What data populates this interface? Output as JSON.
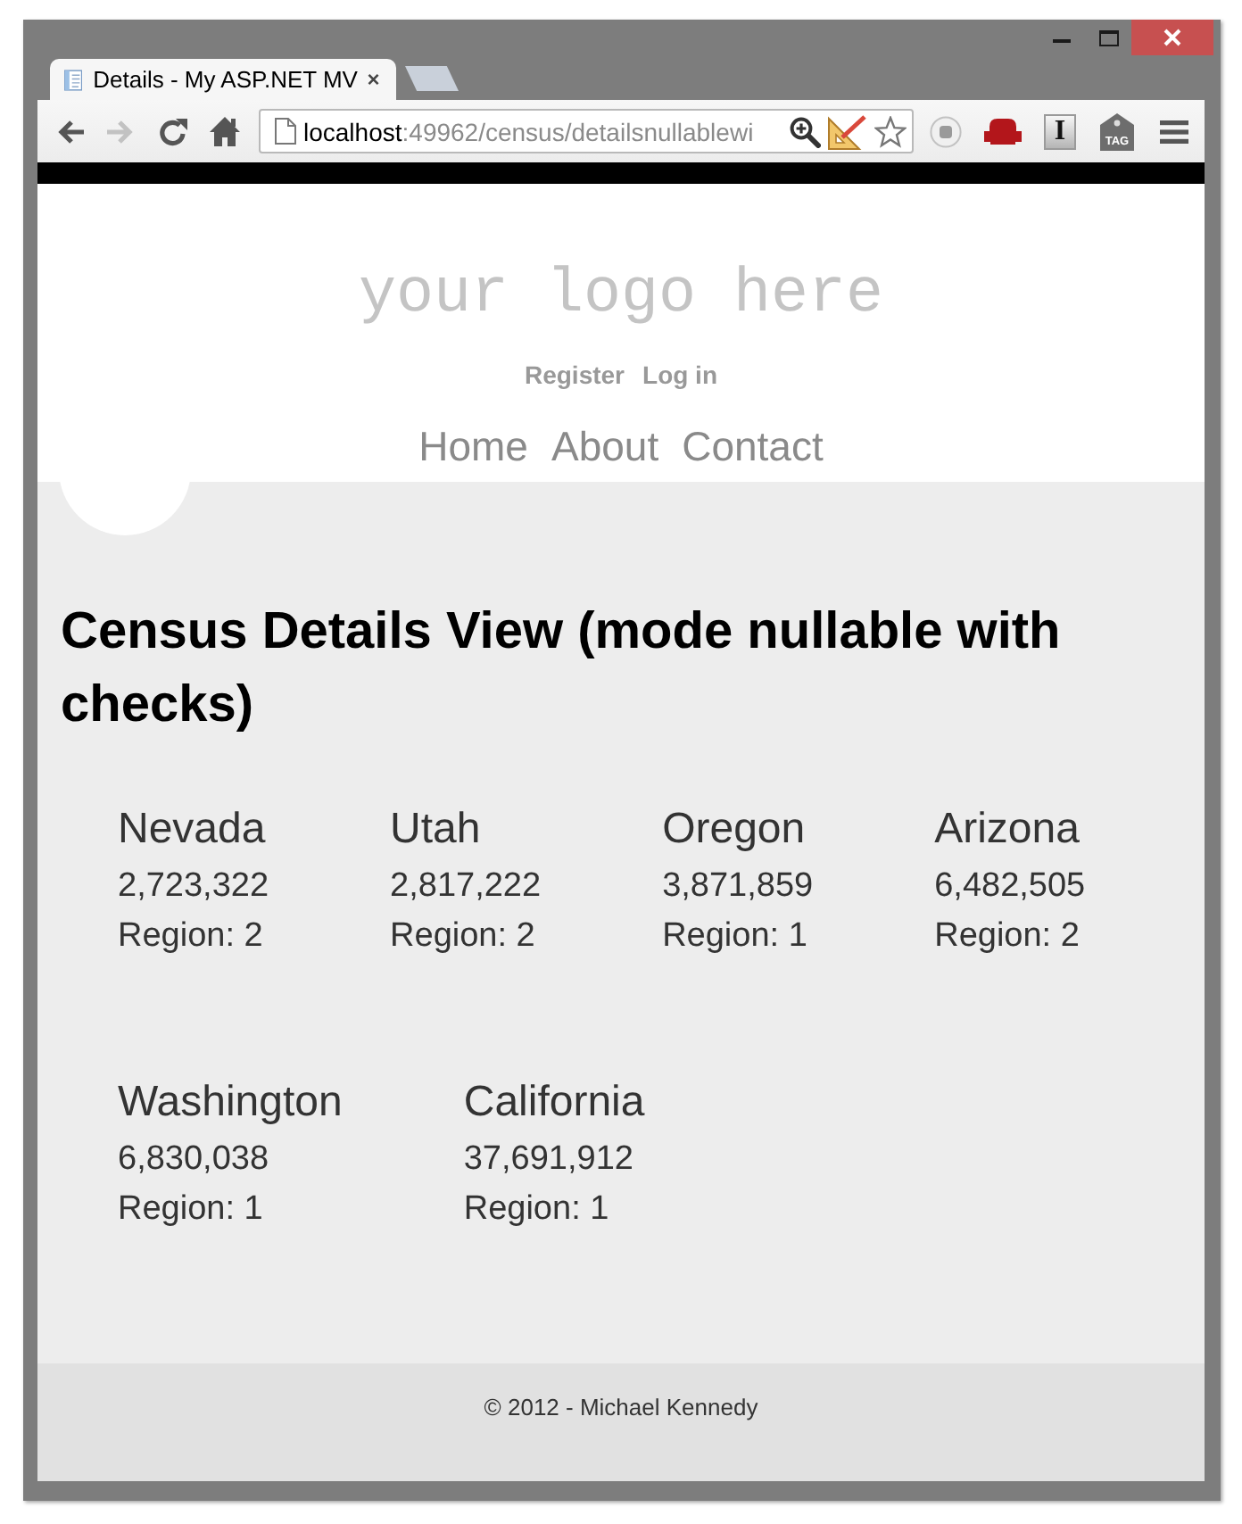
{
  "browser": {
    "tabs": [
      {
        "title": "Details - My ASP.NET MV",
        "selected": true
      }
    ],
    "nav_buttons": [
      {
        "kind": "back",
        "disabled": false
      },
      {
        "kind": "forward",
        "disabled": true
      },
      {
        "kind": "reload",
        "disabled": false
      },
      {
        "kind": "home",
        "disabled": false
      }
    ],
    "address_bar": {
      "host": "localhost",
      "path": ":49962/census/detailsnullablewi"
    },
    "extensions": [
      {
        "kind": "record"
      },
      {
        "kind": "sofa"
      },
      {
        "kind": "letter",
        "label": "I"
      },
      {
        "kind": "tag",
        "label": "TAG"
      }
    ]
  },
  "page": {
    "logo": "your logo here",
    "account_links": [
      "Register",
      "Log in"
    ],
    "nav": [
      "Home",
      "About",
      "Contact"
    ],
    "heading": "Census Details View (mode nullable with checks)",
    "states": [
      {
        "name": "Nevada",
        "population": "2,723,322",
        "region": "Region: 2"
      },
      {
        "name": "Utah",
        "population": "2,817,222",
        "region": "Region: 2"
      },
      {
        "name": "Oregon",
        "population": "3,871,859",
        "region": "Region: 1"
      },
      {
        "name": "Arizona",
        "population": "6,482,505",
        "region": "Region: 2"
      },
      {
        "name": "Washington",
        "population": "6,830,038",
        "region": "Region: 1"
      },
      {
        "name": "California",
        "population": "37,691,912",
        "region": "Region: 1"
      }
    ],
    "footer": "© 2012 - Michael Kennedy"
  }
}
